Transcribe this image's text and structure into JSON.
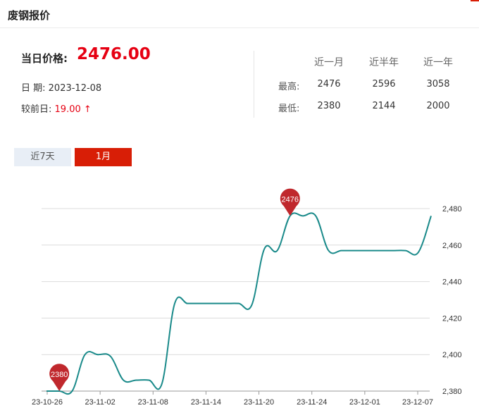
{
  "header": {
    "title": "废钢报价"
  },
  "price": {
    "label": "当日价格:",
    "value": "2476.00",
    "date_label": "日 期:",
    "date": "2023-12-08",
    "change_label": "较前日:",
    "change": "19.00 ↑"
  },
  "stats": {
    "columns": [
      "近一月",
      "近半年",
      "近一年"
    ],
    "rows": [
      {
        "label": "最高:",
        "values": [
          "2476",
          "2596",
          "3058"
        ]
      },
      {
        "label": "最低:",
        "values": [
          "2380",
          "2144",
          "2000"
        ]
      }
    ]
  },
  "tabs": [
    {
      "label": "近7天",
      "active": false
    },
    {
      "label": "1月",
      "active": true
    }
  ],
  "colors": {
    "accent": "#d81e06",
    "line": "#1a8a8a",
    "marker": "#c0282d"
  },
  "chart_data": {
    "type": "line",
    "x_tick_labels": [
      "23-10-26",
      "23-11-02",
      "23-11-08",
      "23-11-14",
      "23-11-20",
      "23-11-24",
      "23-12-01",
      "23-12-07"
    ],
    "y_tick_labels": [
      "2,380",
      "2,400",
      "2,420",
      "2,440",
      "2,460",
      "2,480"
    ],
    "ylim": [
      2380,
      2480
    ],
    "grid": true,
    "series": [
      {
        "values": [
          2380,
          2380,
          2380,
          2400,
          2400,
          2399,
          2386,
          2386,
          2386,
          2384,
          2428,
          2428,
          2428,
          2428,
          2428,
          2428,
          2427,
          2458,
          2457,
          2476,
          2476,
          2476,
          2457,
          2457,
          2457,
          2457,
          2457,
          2457,
          2457,
          2456,
          2476
        ]
      }
    ],
    "markers": [
      {
        "label": "2380",
        "index": 1,
        "value": 2380
      },
      {
        "label": "2476",
        "index": 19,
        "value": 2476
      }
    ]
  }
}
